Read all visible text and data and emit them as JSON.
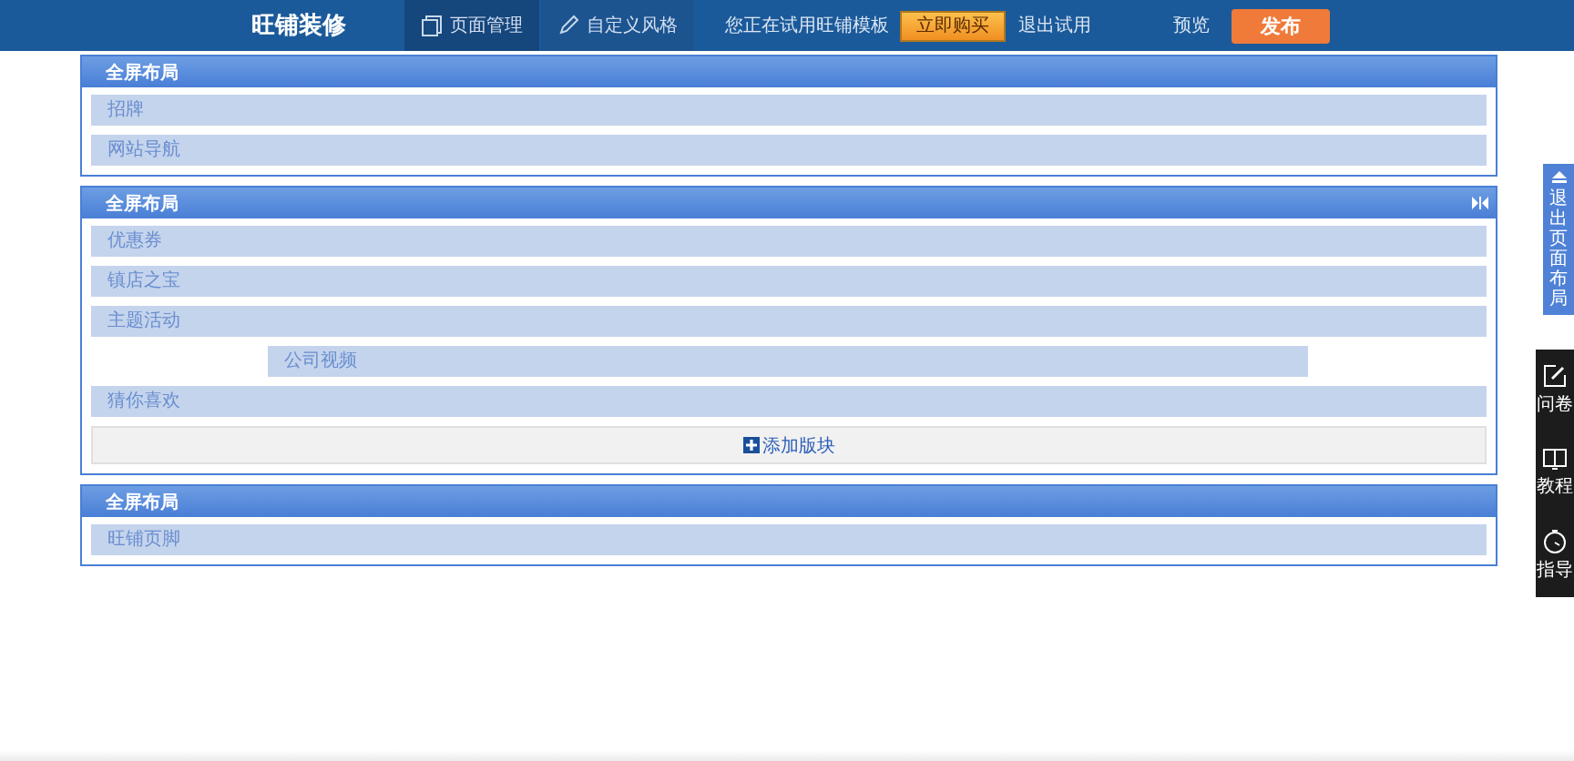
{
  "topbar": {
    "title": "旺铺装修",
    "tabs": [
      {
        "label": "页面管理",
        "selected": true
      },
      {
        "label": "自定义风格",
        "selected": false
      }
    ],
    "trial_note": "您正在试用旺铺模板",
    "buy_button": "立即购买",
    "exit_trial": "退出试用",
    "preview": "预览",
    "publish_button": "发布"
  },
  "panels": [
    {
      "title": "全屏布局",
      "toggle": false,
      "blocks": [
        {
          "label": "招牌",
          "kind": "full"
        },
        {
          "label": "网站导航",
          "kind": "full"
        }
      ]
    },
    {
      "title": "全屏布局",
      "toggle": true,
      "blocks": [
        {
          "label": "优惠券",
          "kind": "full"
        },
        {
          "label": "镇店之宝",
          "kind": "full"
        },
        {
          "label": "主题活动",
          "kind": "full"
        },
        {
          "label": "公司视频",
          "kind": "inset"
        },
        {
          "label": "猜你喜欢",
          "kind": "full"
        }
      ],
      "add_button": "添加版块"
    },
    {
      "title": "全屏布局",
      "toggle": false,
      "blocks": [
        {
          "label": "旺铺页脚",
          "kind": "full"
        }
      ]
    }
  ],
  "exit_layout_tab": "退出页面布局",
  "side_tools": [
    {
      "label": "问卷"
    },
    {
      "label": "教程"
    },
    {
      "label": "指导"
    }
  ]
}
